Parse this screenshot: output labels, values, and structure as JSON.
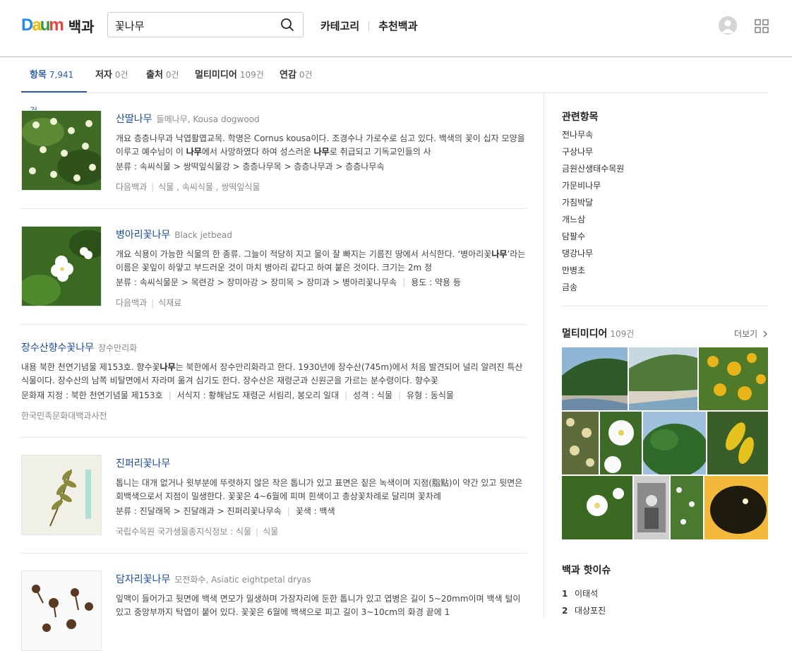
{
  "header": {
    "logo_letters": [
      "D",
      "a",
      "u",
      "m"
    ],
    "service_name": "백과",
    "search_value": "꽃나무",
    "nav": [
      "카테고리",
      "추천백과"
    ]
  },
  "tabs": [
    {
      "label": "항목",
      "count": "7,941건",
      "active": true
    },
    {
      "label": "저자",
      "count": "0건"
    },
    {
      "label": "출처",
      "count": "0건"
    },
    {
      "label": "멀티미디어",
      "count": "109건"
    },
    {
      "label": "연감",
      "count": "0건"
    }
  ],
  "results": [
    {
      "title": "산딸나무",
      "subtitle": "들메나무, Kousa dogwood",
      "desc_parts": [
        "개요 층층나무과 낙엽활엽교목. 학명은 Cornus kousa이다. 조경수나 가로수로 심고 있다. 백색의 꽃이 십자 모양을 이루고 예수님이 이 ",
        "나무",
        "에서 사망하였다 하여 성스러운 ",
        "나무",
        "로 취급되고 기독교인들의 사"
      ],
      "meta": [
        "분류 : 속씨식물 > 쌍떡잎식물강 > 층층나무목 > 층층나무과 > 층층나무속"
      ],
      "source": [
        "다음백과",
        "식물 , 속씨식물 , 쌍떡잎식물"
      ]
    },
    {
      "title": "병아리꽃나무",
      "subtitle": "Black jetbead",
      "desc_parts": [
        "개요 식용이 가능한 식물의 한 종류. 그늘이 적당히 지고 물이 잘 빠지는 기름진 땅에서 서식한다. ‘병아리꽃",
        "나무",
        "’라는 이름은 꽃잎이 하얗고 부드러운 것이 마치 병아리 같다고 하여 붙은 것이다. 크기는 2m 정"
      ],
      "meta": [
        "분류 : 속씨식물문 > 목련강 > 장미아강 > 장미목 > 장미과 > 병아리꽃나무속",
        "용도 : 약용 등"
      ],
      "source": [
        "다음백과",
        "식재료"
      ]
    },
    {
      "title": "장수산향수꽃나무",
      "subtitle": "장수만리화",
      "desc_parts": [
        "내용 북한 천연기념물 제153호. 향수꽃",
        "나무",
        "는 북한에서 장수만리화라고 한다. 1930년에 장수산(745m)에서 처음 발견되어 널리 알려진 특산식물이다. 장수산의 남쪽 비탈면에서 자라며 옮겨 심기도 한다. 장수산은 재령군과 신원군을 가르는 분수령이다. 향수꽃"
      ],
      "meta": [
        "문화재 지정 : 북한 천연기념물 제153호",
        "서식지 : 황해남도 재령군 서림리, 봉오리 일대",
        "성격 : 식물",
        "유형 : 동식물"
      ],
      "source": [
        "한국민족문화대백과사전"
      ]
    },
    {
      "title": "진퍼리꽃나무",
      "subtitle": "",
      "desc_parts": [
        "톱니는 대개 없거나 윗부분에 뚜렷하지 않은 작은 톱니가 있고 표면은 짙은 녹색이며 지점(脂點)이 약간 있고 뒷면은 회백색으로서 지점이 밀생한다. 꽃꽃은 4~6월에 피며 흰색이고 총상꽃차례로 달리며 꽃차례"
      ],
      "meta": [
        "분류 : 진달래목 > 진달래과 > 진퍼리꽃나무속",
        "꽃색 : 백색"
      ],
      "source": [
        "국립수목원 국가생물종지식정보 : 식물",
        "식물"
      ]
    },
    {
      "title": "담자리꽃나무",
      "subtitle": "모전화수, Asiatic eightpetal dryas",
      "desc_parts": [
        "잎맥이 들어가고 뒷면에 백색 면모가 밀생하며 가장자리에 둔한 톱니가 있고 엽병은 길이 5~20mm이며 백색 털이 있고 중앙부까지 탁엽이 붙어 있다. 꽃꽃은 6월에 백색으로 피고 길이 3~10cm의 화경 끝에 1"
      ],
      "meta": [],
      "source": []
    }
  ],
  "related": {
    "title": "관련항목",
    "items": [
      "전나무속",
      "구상나무",
      "금원산생태수목원",
      "가문비나무",
      "가침박달",
      "개느삼",
      "담팔수",
      "댕강나무",
      "만병초",
      "금송"
    ]
  },
  "multimedia": {
    "title": "멀티미디어",
    "count": "109건",
    "more": "더보기"
  },
  "hot": {
    "title": "백과 핫이슈",
    "items": [
      {
        "num": "1",
        "label": "이태석"
      },
      {
        "num": "2",
        "label": "대상포진"
      }
    ]
  },
  "colors": {
    "accent": "#2e5ea8",
    "link": "#1c4b9b"
  }
}
